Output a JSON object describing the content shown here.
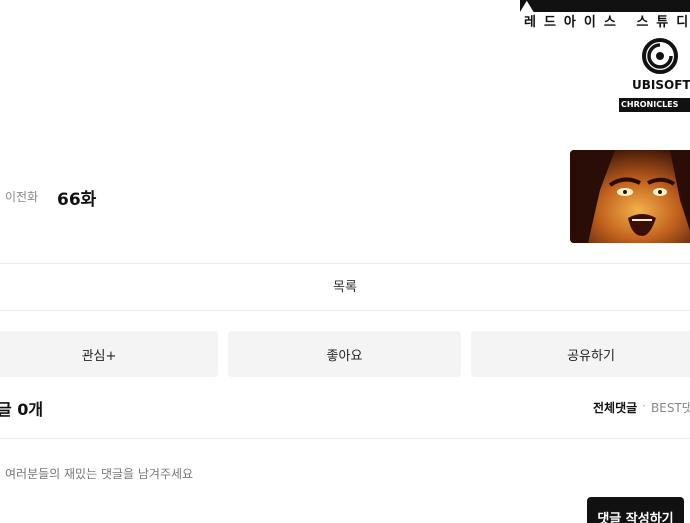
{
  "branding": {
    "studio_sub": "레드아이스 스튜디오",
    "publisher_name": "UBISOFT",
    "publisher_line": "CHRONICLES"
  },
  "episode_nav": {
    "prev_label": "이전화",
    "prev_title": "66화"
  },
  "list_link": "목록",
  "actions": {
    "favorite_label": "관심+",
    "like_label": "좋아요",
    "share_label": "공유하기"
  },
  "comments": {
    "count_label": "글 0개",
    "sort_all": "전체댓글",
    "sort_sep": "·",
    "sort_best": "BEST댓",
    "placeholder": "여러분들의 재밌는 댓글을 남겨주세요",
    "write_button": "댓글 작성하기"
  },
  "colors": {
    "accent_dark": "#111111",
    "button_bg": "#f4f4f4",
    "divider": "#ebebeb"
  }
}
